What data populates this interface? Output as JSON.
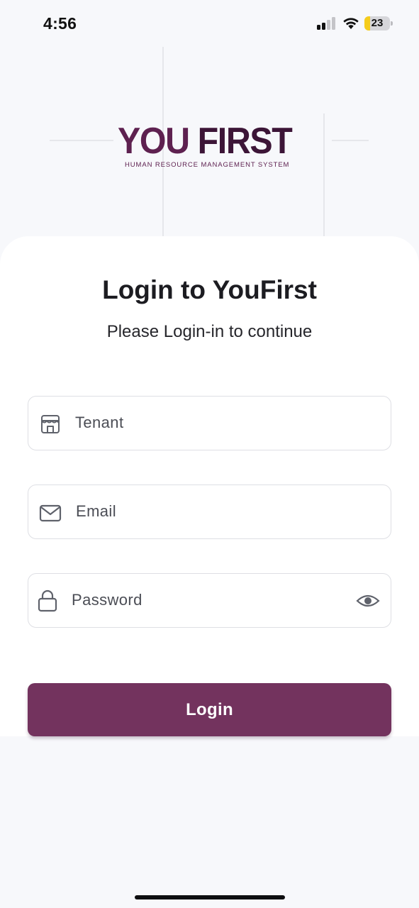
{
  "status_bar": {
    "time": "4:56",
    "battery_level": "23",
    "battery_color": "#f5cc1b",
    "icons": [
      "cellular-signal-icon",
      "wifi-icon",
      "battery-icon"
    ]
  },
  "logo": {
    "word_one": "YOU",
    "word_two": "FIRST",
    "tagline": "HUMAN RESOURCE MANAGEMENT SYSTEM",
    "brand_color": "#5e2150"
  },
  "login": {
    "title": "Login to YouFirst",
    "subtitle": "Please Login-in to continue",
    "tenant_placeholder": "Tenant",
    "tenant_value": "",
    "email_placeholder": "Email",
    "email_value": "",
    "password_placeholder": "Password",
    "password_value": "",
    "button_label": "Login",
    "button_color": "#73335e",
    "icons": [
      "store-icon",
      "mail-icon",
      "lock-icon",
      "eye-icon"
    ]
  }
}
